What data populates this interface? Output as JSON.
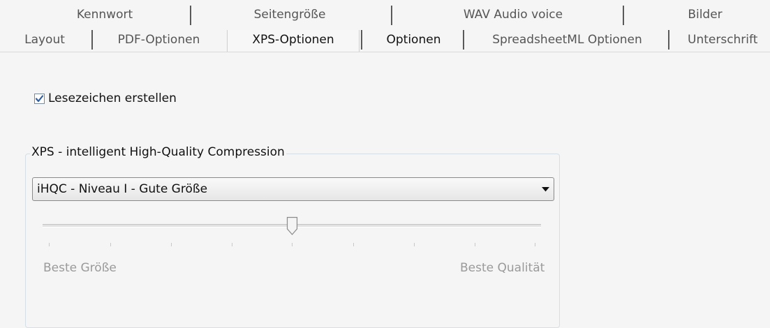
{
  "tabs": {
    "row1": [
      "Kennwort",
      "Seitengröße",
      "WAV Audio voice",
      "Bilder"
    ],
    "row2": [
      "Layout",
      "PDF-Optionen",
      "XPS-Optionen",
      "Optionen",
      "SpreadsheetML Optionen",
      "Unterschrift"
    ],
    "active": "XPS-Optionen"
  },
  "bookmark_checkbox": {
    "label": "Lesezeichen erstellen",
    "checked": true
  },
  "compression_group": {
    "title": "XPS - intelligent High-Quality Compression",
    "select_value": "iHQC - Niveau I - Gute Größe",
    "slider": {
      "level": 4,
      "min": 0,
      "max": 8,
      "min_label": "Beste Größe",
      "max_label": "Beste Qualität"
    }
  },
  "colors": {
    "checkmark": "#2b5fa8",
    "border": "#d5dfe5"
  },
  "icons": {
    "checkbox": "checkmark-icon",
    "dropdown": "chevron-down-icon"
  }
}
